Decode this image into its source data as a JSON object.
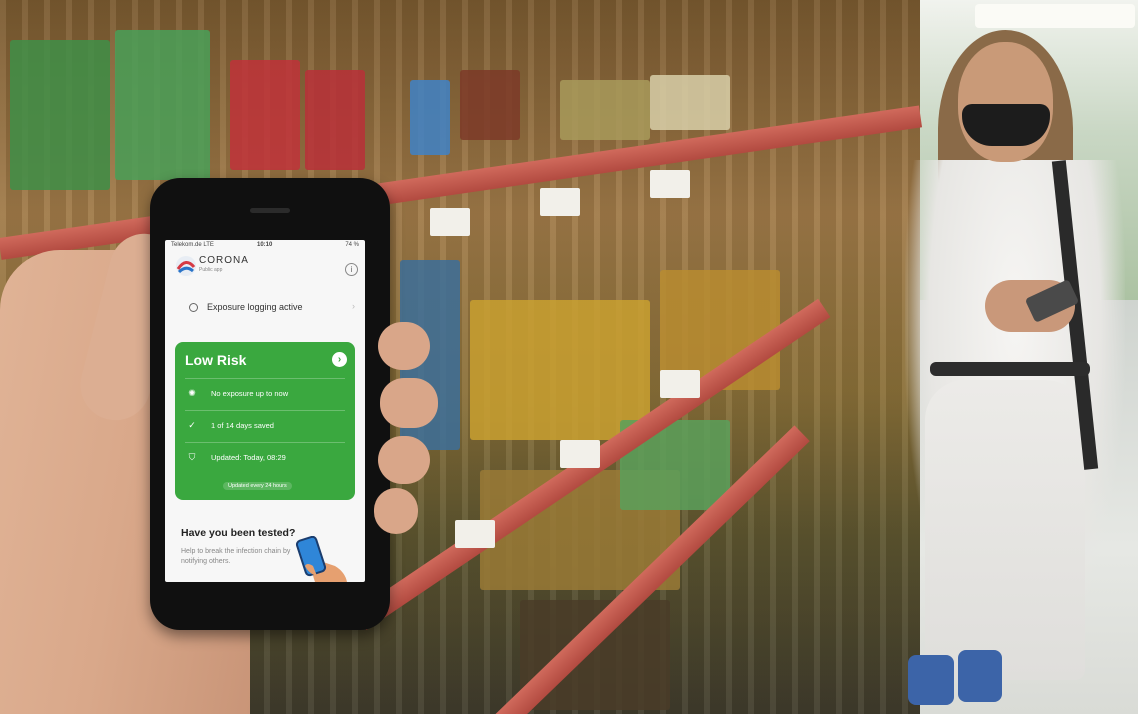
{
  "phone_app": {
    "status_bar": {
      "carrier": "Telekom.de LTE",
      "time": "10:10",
      "battery": "74 %"
    },
    "header": {
      "app_name": "CORONA",
      "app_subtitle": "Public app"
    },
    "exposure_logging": {
      "label": "Exposure logging active"
    },
    "risk_card": {
      "title": "Low Risk",
      "rows": [
        {
          "icon": "virus-icon",
          "text": "No exposure up to now"
        },
        {
          "icon": "check-circle-icon",
          "text": "1 of 14 days saved"
        },
        {
          "icon": "shield-icon",
          "text": "Updated: Today, 08:29"
        }
      ],
      "footer": "Updated every 24 hours",
      "color": "#3aa83f"
    },
    "tested_card": {
      "title": "Have you been tested?",
      "body": "Help to break the infection chain by notifying others."
    }
  }
}
